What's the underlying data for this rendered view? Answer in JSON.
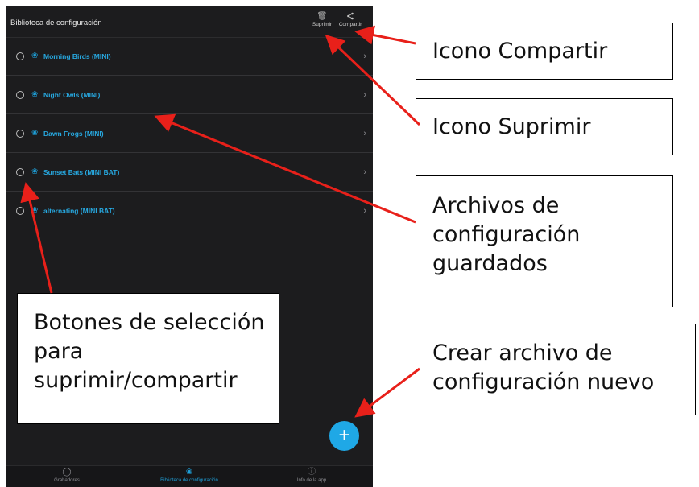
{
  "app": {
    "title": "Biblioteca de configuración",
    "actions": {
      "delete_label": "Suprimir",
      "share_label": "Compartir",
      "delete_icon": "trash-icon",
      "share_icon": "share-icon"
    },
    "config_files": [
      {
        "name": "Morning Birds (MINI)"
      },
      {
        "name": "Night Owls (MINI)"
      },
      {
        "name": "Dawn Frogs (MINI)"
      },
      {
        "name": "Sunset Bats (MINI BAT)"
      },
      {
        "name": "alternating (MINI BAT)"
      }
    ],
    "fab_label": "+",
    "tabs": [
      {
        "label": "Grabadores",
        "icon": "microphone-icon",
        "active": false
      },
      {
        "label": "Biblioteca de configuración",
        "icon": "library-icon",
        "active": true
      },
      {
        "label": "Info de la app",
        "icon": "info-icon",
        "active": false
      }
    ],
    "accent_color": "#1fa8e6"
  },
  "callouts": {
    "share_icon": "Icono Compartir",
    "delete_icon": "Icono Suprimir",
    "saved_files": "Archivos de configuración guardados",
    "selection_buttons": "Botones de selección para suprimir/compartir",
    "new_file": "Crear archivo de configuración nuevo"
  }
}
